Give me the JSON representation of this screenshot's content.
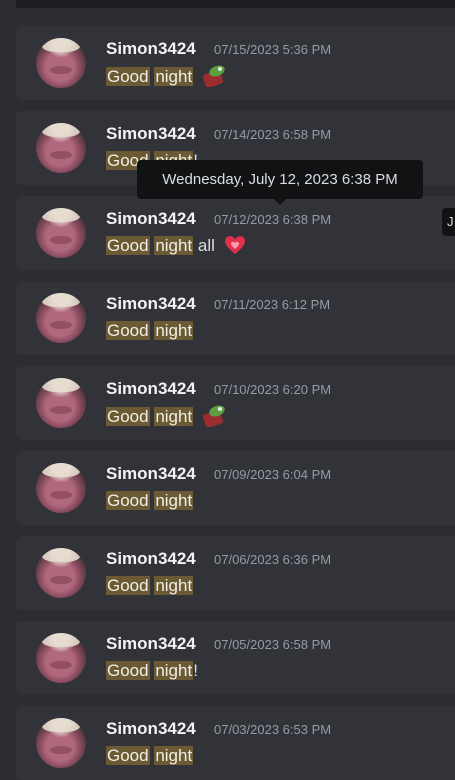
{
  "messages": [
    {
      "username": "Simon3424",
      "timestamp": "07/15/2023 5:36 PM",
      "hl1": "Good",
      "hl2": "night",
      "tail": "",
      "emoji": "frog-emoji"
    },
    {
      "username": "Simon3424",
      "timestamp": "07/14/2023 6:58 PM",
      "hl1": "Good",
      "hl2": "night",
      "tail": "!",
      "emoji": ""
    },
    {
      "username": "Simon3424",
      "timestamp": "07/12/2023 6:38 PM",
      "hl1": "Good",
      "hl2": "night",
      "tail": " all",
      "emoji": "heart-emoji"
    },
    {
      "username": "Simon3424",
      "timestamp": "07/11/2023 6:12 PM",
      "hl1": "Good",
      "hl2": "night",
      "tail": "",
      "emoji": ""
    },
    {
      "username": "Simon3424",
      "timestamp": "07/10/2023 6:20 PM",
      "hl1": "Good",
      "hl2": "night",
      "tail": "",
      "emoji": "frog-emoji"
    },
    {
      "username": "Simon3424",
      "timestamp": "07/09/2023 6:04 PM",
      "hl1": "Good",
      "hl2": "night",
      "tail": "",
      "emoji": ""
    },
    {
      "username": "Simon3424",
      "timestamp": "07/06/2023 6:36 PM",
      "hl1": "Good",
      "hl2": "night",
      "tail": "",
      "emoji": ""
    },
    {
      "username": "Simon3424",
      "timestamp": "07/05/2023 6:58 PM",
      "hl1": "Good",
      "hl2": "night",
      "tail": "!",
      "emoji": ""
    },
    {
      "username": "Simon3424",
      "timestamp": "07/03/2023 6:53 PM",
      "hl1": "Good",
      "hl2": "night",
      "tail": "",
      "emoji": ""
    }
  ],
  "tooltip": {
    "text": "Wednesday, July 12, 2023 6:38 PM"
  },
  "edge_tooltip": {
    "text": "J"
  },
  "colors": {
    "background": "#2b2d31",
    "card": "#313338",
    "highlight": "#6b5a34",
    "tooltip": "#111214"
  }
}
